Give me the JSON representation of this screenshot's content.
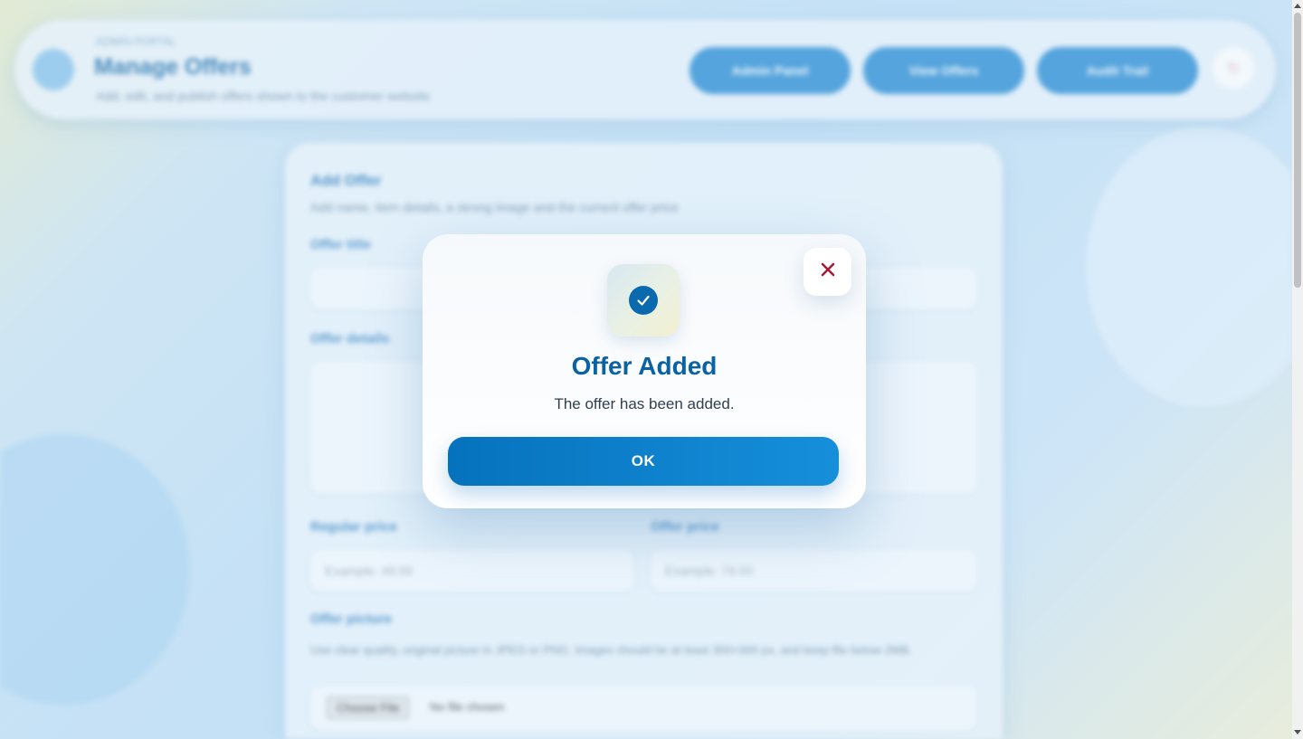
{
  "header": {
    "kicker": "ADMIN PORTAL",
    "title": "Manage Offers",
    "subtitle": "Add, edit, and publish offers shown to the customer website",
    "nav_buttons": [
      "Admin Panel",
      "View Offers",
      "Audit Trail"
    ],
    "exit_icon": "logout-icon"
  },
  "form": {
    "title": "Add Offer",
    "subtitle": "Add name, item details, a strong image and the current offer price",
    "offer_title_label": "Offer title",
    "offer_details_label": "Offer details",
    "regular_price_label": "Regular price",
    "regular_price_placeholder": "Example: 49.00",
    "offer_price_label": "Offer price",
    "offer_price_placeholder": "Example: 79.00",
    "offer_picture_label": "Offer picture",
    "offer_picture_help": "Use clear quality, original picture in JPEG or PNG. Images should be at least 300×300 px, and keep file below 2MB.",
    "file_button": "Choose File",
    "file_status": "No file chosen"
  },
  "dialog": {
    "icon": "check-circle-icon",
    "close_icon": "close-icon",
    "title": "Offer Added",
    "message": "The offer has been added.",
    "ok_label": "OK"
  },
  "colors": {
    "accent": "#0a6aad",
    "title": "#0a62a3",
    "button_start": "#0672bd",
    "button_end": "#168fda",
    "close": "#a01d3c"
  }
}
